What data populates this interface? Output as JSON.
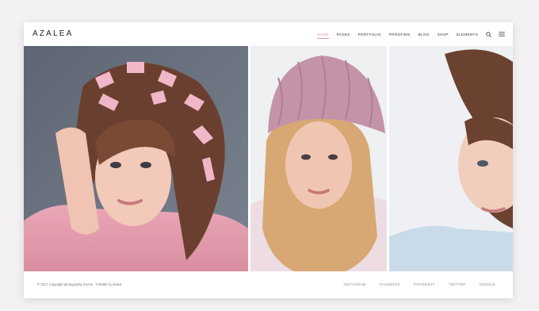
{
  "header": {
    "logo": "AZALEA",
    "nav": [
      "HOME",
      "PAGES",
      "PORTFOLIO",
      "PROOFING",
      "BLOG",
      "SHOP",
      "ELEMENTS"
    ],
    "active_nav": "HOME",
    "icons": [
      "search-icon",
      "menu-icon"
    ]
  },
  "gallery": {
    "photos": [
      "portrait-with-pink-ribbons",
      "portrait-with-knit-beanie",
      "portrait-in-blue-shirt"
    ]
  },
  "footer": {
    "copyright": "© 2017 Copyright photography theme - THEME by elated",
    "social": [
      "INSTAGRAM",
      "FACEBOOK",
      "PINTEREST",
      "TWITTER",
      "GOOGLE"
    ]
  },
  "colors": {
    "accent": "#e394b5",
    "background": "#f3f1f3",
    "frame": "#ffffff"
  }
}
